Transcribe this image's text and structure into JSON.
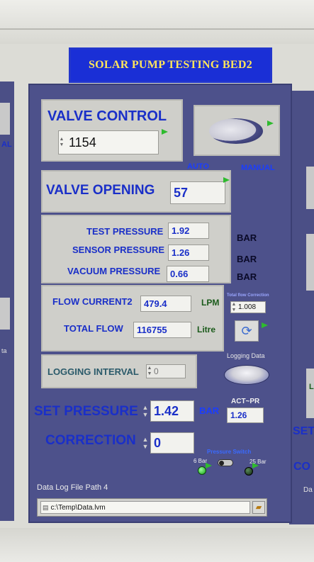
{
  "title": "SOLAR PUMP TESTING BED2",
  "valve_control": {
    "label": "VALVE CONTROL",
    "value": "1154"
  },
  "mode_switch": {
    "auto_label": "AUTO",
    "manual_label": "MANUAL"
  },
  "valve_opening": {
    "label": "VALVE OPENING",
    "value": "57"
  },
  "pressures": {
    "unit": "BAR",
    "rows": [
      {
        "label": "TEST PRESSURE",
        "value": "1.92"
      },
      {
        "label": "SENSOR PRESSURE",
        "value": "1.26"
      },
      {
        "label": "VACUUM PRESSURE",
        "value": "0.66"
      }
    ]
  },
  "flow": {
    "current_label": "FLOW CURRENT2",
    "current_value": "479.4",
    "current_unit": "LPM",
    "total_label": "TOTAL FLOW",
    "total_value": "116755",
    "total_unit": "Litre",
    "correction_label": "Total flow Correction",
    "correction_value": "1.008"
  },
  "logging": {
    "interval_label": "LOGGING INTERVAL",
    "interval_value": "0",
    "data_label": "Logging Data"
  },
  "set_pressure": {
    "label": "SET PRESSURE",
    "value": "1.42",
    "unit": "BAR",
    "act_label": "ACT~PR",
    "act_value": "1.26"
  },
  "correction": {
    "label": "CORRECTION",
    "value": "0"
  },
  "pressure_switch": {
    "label": "Pressure Switch",
    "opt_low": "6 Bar",
    "opt_high": "25 Bar"
  },
  "file_path": {
    "label": "Data Log File Path 4",
    "value": "c:\\Temp\\Data.lvm"
  },
  "side_fragments": {
    "left_text": "AL",
    "left_small": "ta",
    "right_set": "SET",
    "right_co": "CO",
    "right_l": "L",
    "right_da": "Da"
  },
  "colors": {
    "panel": "#4d518b",
    "label_blue": "#1a2fc8",
    "title_bg": "#1a2fd6",
    "title_text": "#ffe55a",
    "led_green": "#2ebb2e"
  }
}
